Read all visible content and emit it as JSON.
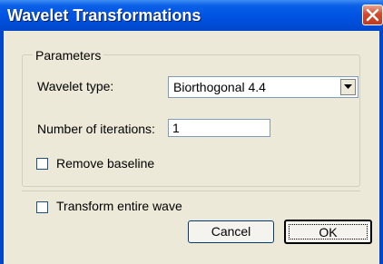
{
  "window": {
    "title": "Wavelet Transformations"
  },
  "parameters": {
    "legend": "Parameters",
    "wavelet_type_label": "Wavelet type:",
    "wavelet_type_value": "Biorthogonal 4.4",
    "iterations_label": "Number of iterations:",
    "iterations_value": "1",
    "remove_baseline_label": "Remove baseline",
    "remove_baseline_checked": false
  },
  "transform_entire_wave": {
    "label": "Transform entire wave",
    "checked": false
  },
  "buttons": {
    "cancel": "Cancel",
    "ok": "OK"
  },
  "colors": {
    "title_bar": "#0054e3",
    "close_button": "#d24a2b",
    "dialog_bg": "#ece9d8"
  },
  "icons": {
    "close": "close-x-icon",
    "dropdown": "chevron-down-icon"
  }
}
